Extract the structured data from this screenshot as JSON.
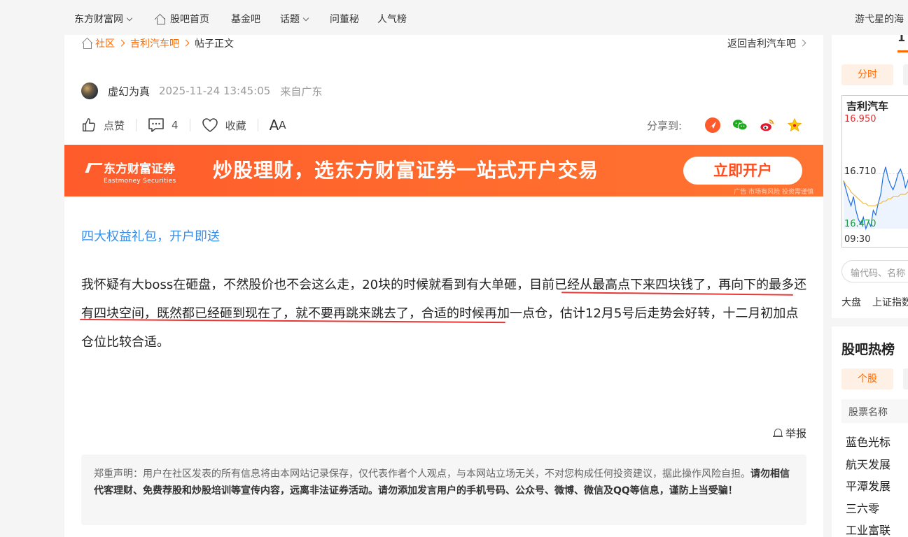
{
  "topnav": {
    "brand": "东方财富网",
    "home": "股吧首页",
    "fund": "基金吧",
    "topics": "话题",
    "ask": "问董秘",
    "popular": "人气榜",
    "user": "游弋星的海"
  },
  "breadcrumb": {
    "community": "社区",
    "bar": "吉利汽车吧",
    "current": "帖子正文",
    "back": "返回吉利汽车吧"
  },
  "post": {
    "author": "虚幻为真",
    "time": "2025-11-24 13:45:05",
    "location": "来自广东",
    "like_label": "点赞",
    "comment_count": "4",
    "favorite_label": "收藏",
    "font_big": "A",
    "font_small": "A",
    "share_label": "分享到:",
    "promo_link": "四大权益礼包，开户即送",
    "body_part1": "我怀疑有大boss在砸盘，不然股价也不会这么走，20块的时候就看到有大单砸，",
    "body_part2": "目前已经从最高点下来四块钱了，再向下的最多还有四块空间，既然都已经砸到现在了，就不要再跳来跳去了",
    "body_part3": "，合适的时候再加一点仓，估计12月5号后走势会好转，十二月初加点仓位比较合适。",
    "report": "举报",
    "disclaimer_normal": "郑重声明：用户在社区发表的所有信息将由本网站记录保存，仅代表作者个人观点，与本网站立场无关，不对您构成任何投资建议，据此操作风险自担。",
    "disclaimer_bold": "请勿相信代客理财、免费荐股和炒股培训等宣传内容，远离非法证券活动。请勿添加发言用户的手机号码、公众号、微博、微信及QQ等信息，谨防上当受骗！"
  },
  "banner": {
    "logo": "东方财富证券",
    "logo_en": "Eastmoney Securities",
    "slogan": "炒股理财，选东方财富证券一站式开户交易",
    "button": "立即开户",
    "note": "广告 市场有风险 投资需谨慎"
  },
  "sidebar": {
    "tab_number": "1",
    "minute_tab": "分时",
    "stock_name": "吉利汽车",
    "price_high": "16.950",
    "price_mid": "16.710",
    "price_low": "16.470",
    "time_start": "09:30",
    "search_placeholder": "输代码、名称",
    "index_a": "大盘",
    "index_b": "上证指数",
    "hot_title": "股吧热榜",
    "hot_tab": "个股",
    "hot_header": "股票名称",
    "hot_list": [
      "蓝色光标",
      "航天发展",
      "平潭发展",
      "三六零",
      "工业富联"
    ]
  },
  "colors": {
    "accent": "#ff6a00",
    "banner": "#ff5b2b",
    "link": "#3a8ee6",
    "underline": "#e53935",
    "price_up": "#e03030",
    "price_down": "#1a9a3c"
  },
  "chart_data": {
    "type": "line",
    "title": "吉利汽车",
    "x_start": "09:30",
    "ylim": [
      16.47,
      16.95
    ],
    "reference": 16.71,
    "series": [
      {
        "values": [
          16.68,
          16.64,
          16.6,
          16.57,
          16.61,
          16.55,
          16.51,
          16.49,
          16.52,
          16.47,
          16.5,
          16.48,
          16.55,
          16.53,
          16.58,
          16.62,
          16.7,
          16.74,
          16.69,
          16.66,
          16.64,
          16.67,
          16.71,
          16.73,
          16.7,
          16.65,
          16.68,
          16.72,
          16.69,
          16.66,
          16.63
        ]
      },
      {
        "values": [
          16.68,
          16.66,
          16.65,
          16.63,
          16.62,
          16.61,
          16.6,
          16.59,
          16.58,
          16.58,
          16.57,
          16.57,
          16.57,
          16.57,
          16.58,
          16.58,
          16.59,
          16.59,
          16.6,
          16.6,
          16.61,
          16.61,
          16.61,
          16.62,
          16.62,
          16.62,
          16.63,
          16.63,
          16.63,
          16.63,
          16.63
        ]
      }
    ]
  }
}
